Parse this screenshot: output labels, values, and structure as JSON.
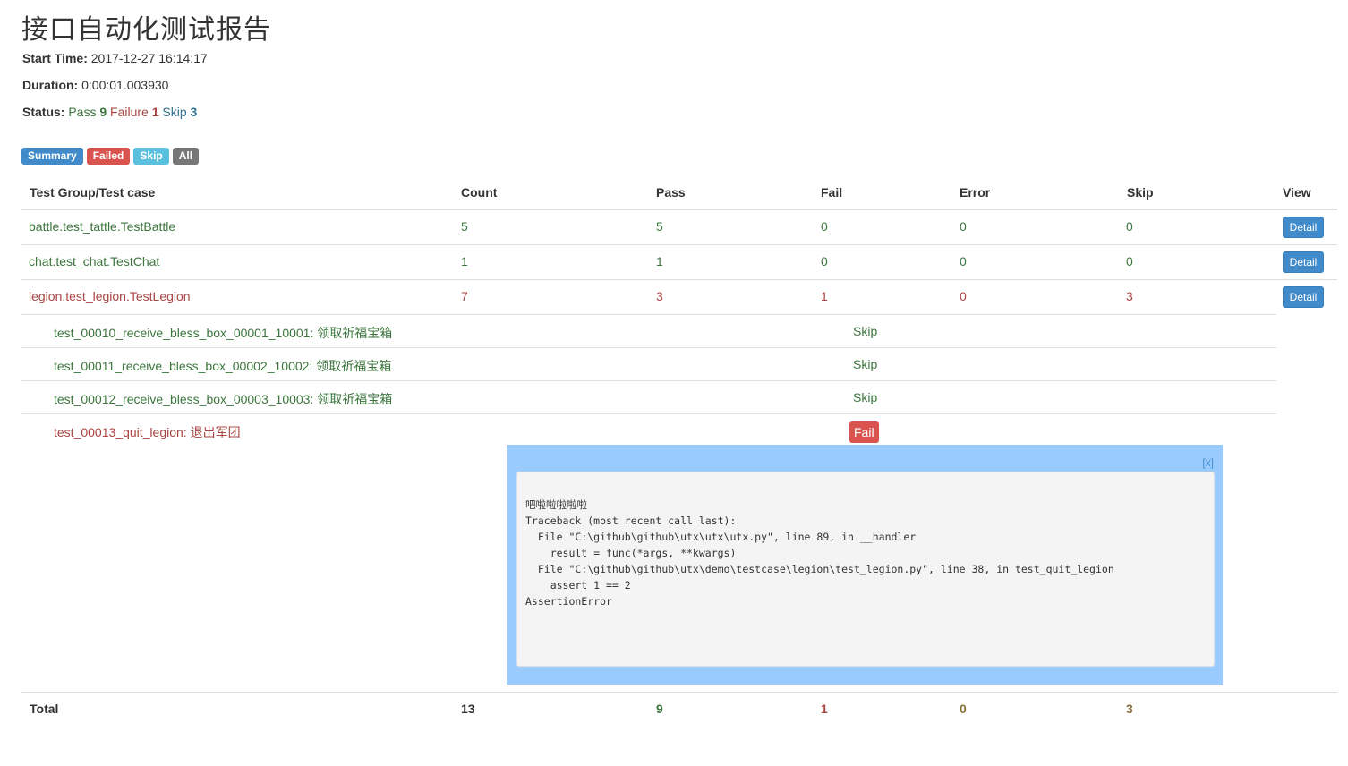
{
  "report": {
    "title": "接口自动化测试报告",
    "start_time_label": "Start Time:",
    "start_time": "2017-12-27 16:14:17",
    "duration_label": "Duration:",
    "duration": "0:00:01.003930",
    "status_label": "Status:",
    "pass_label": "Pass",
    "pass_count": "9",
    "failure_label": "Failure",
    "failure_count": "1",
    "skip_label": "Skip",
    "skip_count": "3"
  },
  "tabs": {
    "summary": "Summary",
    "failed": "Failed",
    "skip": "Skip",
    "all": "All"
  },
  "columns": {
    "group": "Test Group/Test case",
    "count": "Count",
    "pass": "Pass",
    "fail": "Fail",
    "error": "Error",
    "skip": "Skip",
    "view": "View"
  },
  "groups": [
    {
      "name": "battle.test_tattle.TestBattle",
      "count": "5",
      "pass": "5",
      "fail": "0",
      "error": "0",
      "skip": "0",
      "view": "Detail"
    },
    {
      "name": "chat.test_chat.TestChat",
      "count": "1",
      "pass": "1",
      "fail": "0",
      "error": "0",
      "skip": "0",
      "view": "Detail"
    },
    {
      "name": "legion.test_legion.TestLegion",
      "count": "7",
      "pass": "3",
      "fail": "1",
      "error": "0",
      "skip": "3",
      "view": "Detail"
    }
  ],
  "cases": [
    {
      "name": "test_00010_receive_bless_box_00001_10001: 领取祈福宝箱",
      "status": "Skip"
    },
    {
      "name": "test_00011_receive_bless_box_00002_10002: 领取祈福宝箱",
      "status": "Skip"
    },
    {
      "name": "test_00012_receive_bless_box_00003_10003: 领取祈福宝箱",
      "status": "Skip"
    },
    {
      "name": "test_00013_quit_legion: 退出军团",
      "status": "Fail"
    }
  ],
  "popup": {
    "close": "[x]",
    "output": "吧啦啦啦啦啦\nTraceback (most recent call last):\n  File \"C:\\github\\github\\utx\\utx\\utx.py\", line 89, in __handler\n    result = func(*args, **kwargs)\n  File \"C:\\github\\github\\utx\\demo\\testcase\\legion\\test_legion.py\", line 38, in test_quit_legion\n    assert 1 == 2\nAssertionError"
  },
  "total": {
    "label": "Total",
    "count": "13",
    "pass": "9",
    "fail": "1",
    "error": "0",
    "skip": "3"
  },
  "colors": {
    "pass": "#3c763d",
    "fail": "#a94442",
    "skip": "#31708f",
    "primary": "#428bca",
    "danger": "#d9534f",
    "info": "#5bc0de",
    "popup_bg": "#99cbff"
  }
}
